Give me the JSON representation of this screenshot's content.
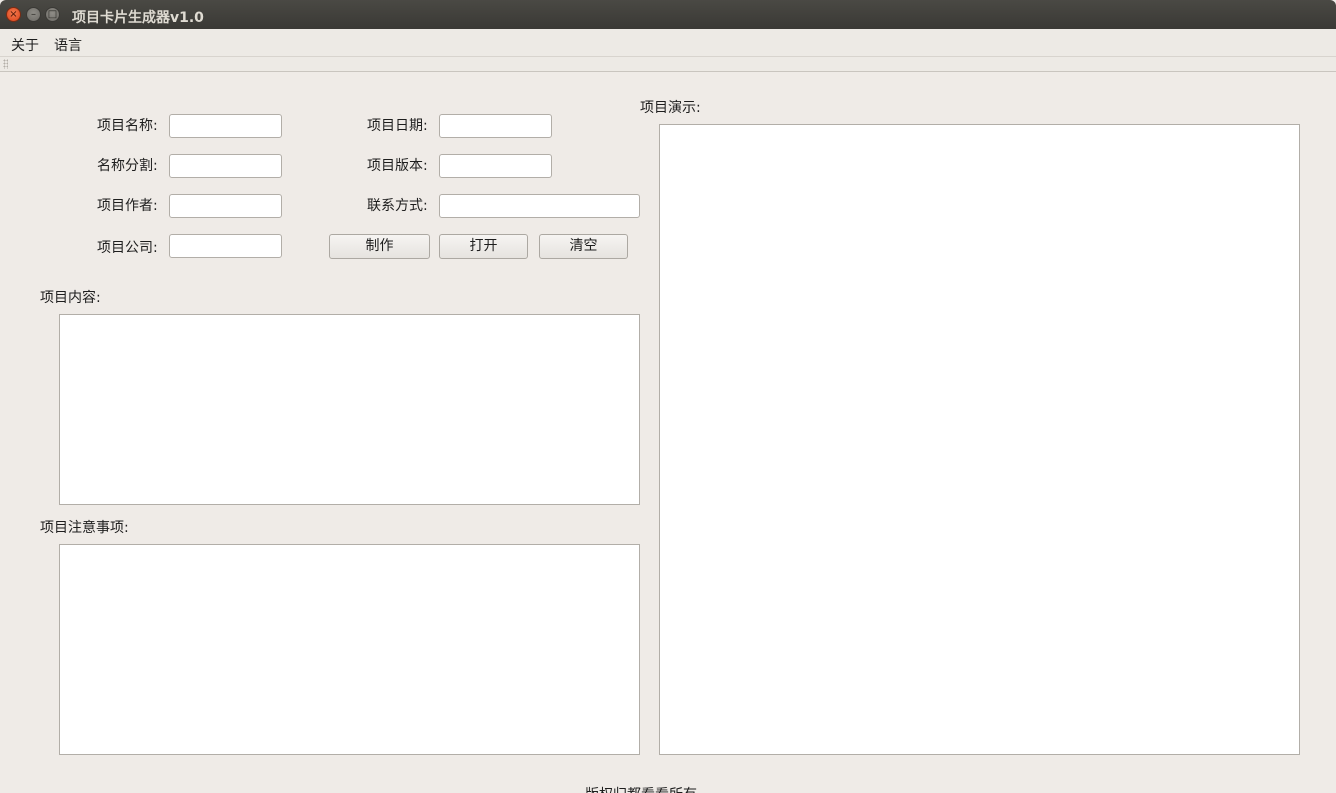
{
  "window": {
    "title": "项目卡片生成器v1.0",
    "controls": {
      "close_glyph": "×",
      "min_glyph": "–",
      "max_glyph": "□"
    }
  },
  "menu": {
    "items": [
      "关于",
      "语言"
    ]
  },
  "form": {
    "name_label": "项目名称:",
    "split_label": "名称分割:",
    "author_label": "项目作者:",
    "company_label": "项目公司:",
    "date_label": "项目日期:",
    "version_label": "项目版本:",
    "contact_label": "联系方式:",
    "name_value": "",
    "split_value": "",
    "author_value": "",
    "company_value": "",
    "date_value": "",
    "version_value": "",
    "contact_value": ""
  },
  "buttons": {
    "make": "制作",
    "open": "打开",
    "clear": "清空"
  },
  "content": {
    "label": "项目内容:",
    "value": ""
  },
  "notes": {
    "label": "项目注意事项:",
    "value": ""
  },
  "preview": {
    "label": "项目演示:"
  },
  "footer": {
    "text": "版权归都看看所有"
  }
}
